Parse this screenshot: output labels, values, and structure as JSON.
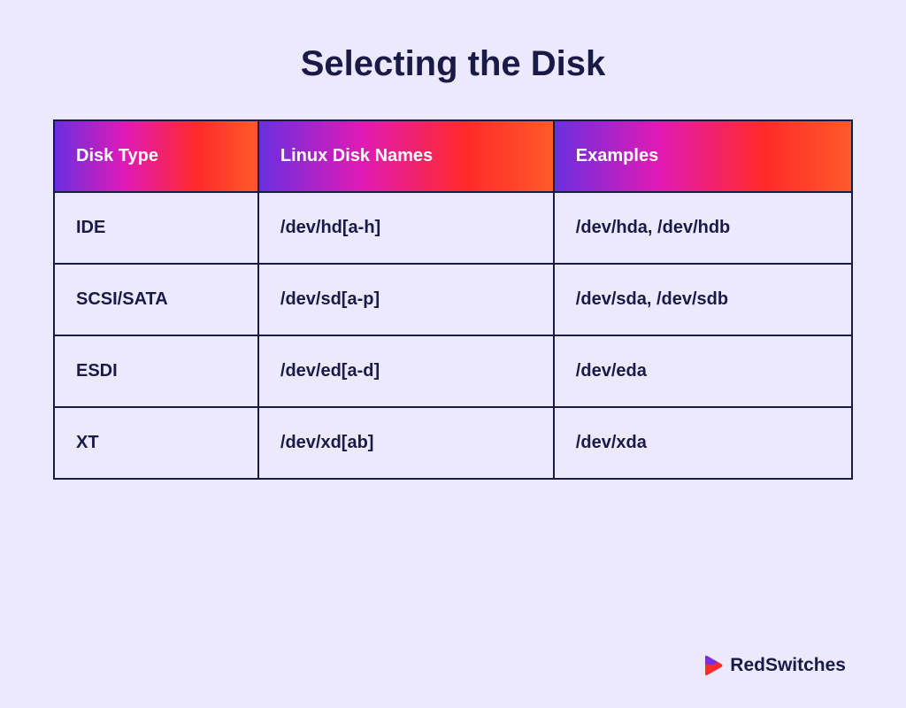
{
  "title": "Selecting  the Disk",
  "chart_data": {
    "type": "table",
    "columns": [
      "Disk Type",
      "Linux Disk Names",
      "Examples"
    ],
    "rows": [
      [
        "IDE",
        "/dev/hd[a-h]",
        "/dev/hda, /dev/hdb"
      ],
      [
        "SCSI/SATA",
        "/dev/sd[a-p]",
        "/dev/sda, /dev/sdb"
      ],
      [
        "ESDI",
        "/dev/ed[a-d]",
        "/dev/eda"
      ],
      [
        "XT",
        "/dev/xd[ab]",
        "/dev/xda"
      ]
    ]
  },
  "table": {
    "headers": {
      "c0": "Disk Type",
      "c1": "Linux Disk Names",
      "c2": "Examples"
    },
    "rows": [
      {
        "c0": "IDE",
        "c1": "/dev/hd[a-h]",
        "c2": "/dev/hda, /dev/hdb"
      },
      {
        "c0": "SCSI/SATA",
        "c1": "/dev/sd[a-p]",
        "c2": "/dev/sda, /dev/sdb"
      },
      {
        "c0": "ESDI",
        "c1": "/dev/ed[a-d]",
        "c2": "/dev/eda"
      },
      {
        "c0": "XT",
        "c1": "/dev/xd[ab]",
        "c2": "/dev/xda"
      }
    ]
  },
  "logo": {
    "text": "RedSwitches"
  }
}
